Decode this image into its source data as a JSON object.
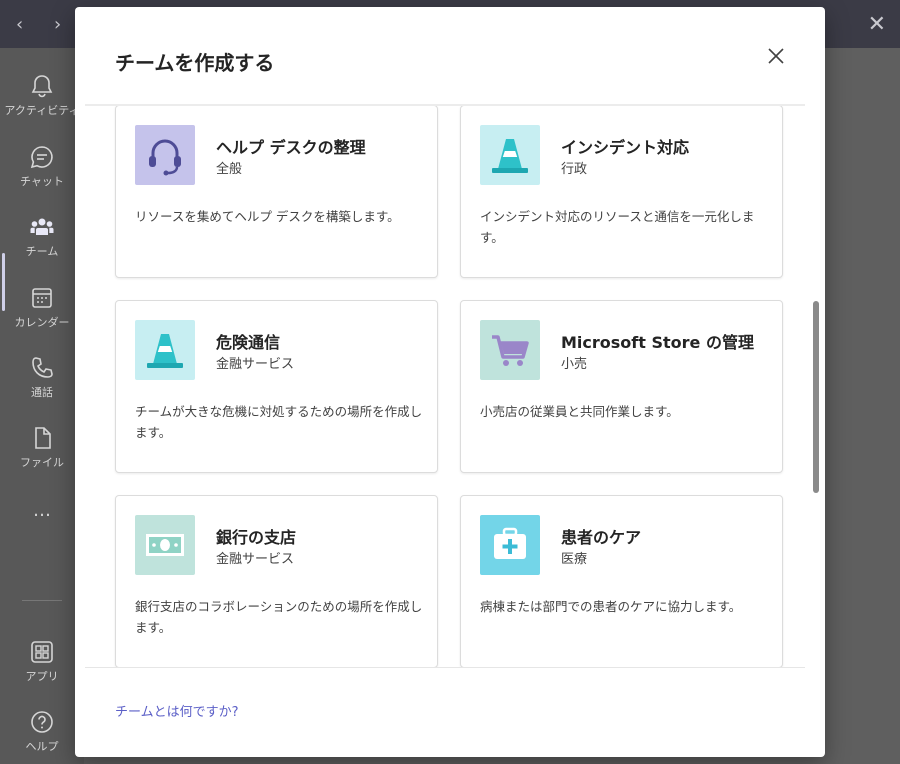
{
  "dialog": {
    "title": "チームを作成する",
    "footer_link": "チームとは何ですか?"
  },
  "rail": {
    "items": [
      {
        "label": "アクティビティ",
        "icon": "bell-icon"
      },
      {
        "label": "チャット",
        "icon": "chat-icon"
      },
      {
        "label": "チーム",
        "icon": "teams-icon"
      },
      {
        "label": "カレンダー",
        "icon": "calendar-icon"
      },
      {
        "label": "通話",
        "icon": "phone-icon"
      },
      {
        "label": "ファイル",
        "icon": "file-icon"
      },
      {
        "label": "アプリ",
        "icon": "apps-icon"
      },
      {
        "label": "ヘルプ",
        "icon": "help-icon"
      }
    ],
    "more": "…"
  },
  "templates": [
    {
      "title": "ヘルプ デスクの整理",
      "category": "全般",
      "description": "リソースを集めてヘルプ デスクを構築します。",
      "icon": "headset-icon",
      "icon_bg": "#c5c3eb"
    },
    {
      "title": "インシデント対応",
      "category": "行政",
      "description": "インシデント対応のリソースと通信を一元化します。",
      "icon": "traffic-cone-icon",
      "icon_bg": "#c7eef2"
    },
    {
      "title": "危険通信",
      "category": "金融サービス",
      "description": "チームが大きな危機に対処するための場所を作成します。",
      "icon": "traffic-cone-icon",
      "icon_bg": "#c7eef2"
    },
    {
      "title": "Microsoft Store の管理",
      "category": "小売",
      "description": "小売店の従業員と共同作業します。",
      "icon": "shopping-cart-icon",
      "icon_bg": "#bfe3dc"
    },
    {
      "title": "銀行の支店",
      "category": "金融サービス",
      "description": "銀行支店のコラボレーションのための場所を作成します。",
      "icon": "banknote-icon",
      "icon_bg": "#bfe3dc"
    },
    {
      "title": "患者のケア",
      "category": "医療",
      "description": "病棟または部門での患者のケアに協力します。",
      "icon": "medical-kit-icon",
      "icon_bg": "#73d5e8"
    }
  ],
  "colors": {
    "accent": "#5b5fc7",
    "title_text": "#242424",
    "body_text": "#424242"
  }
}
